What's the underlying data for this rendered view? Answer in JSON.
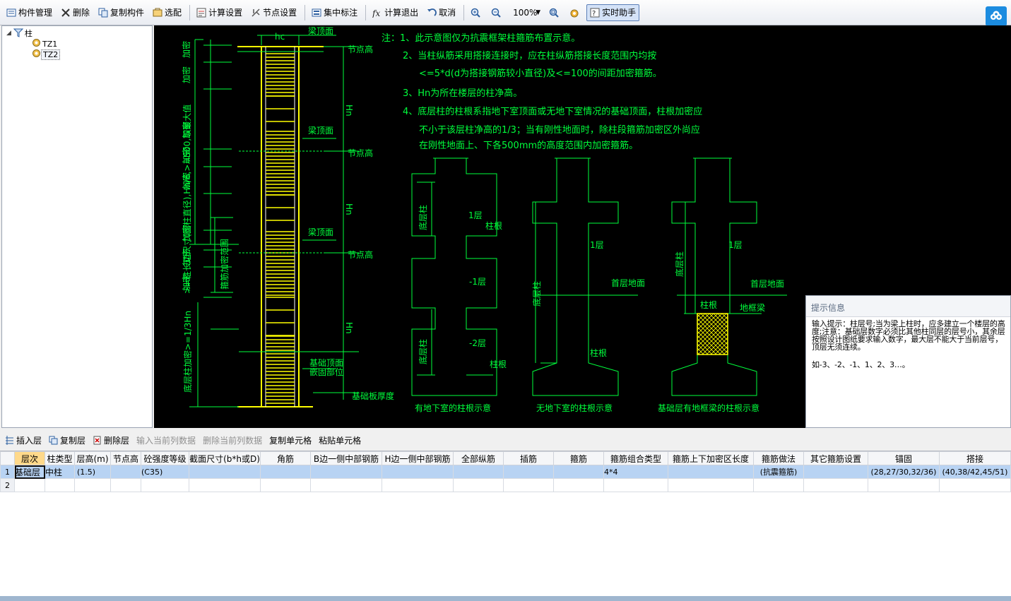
{
  "toolbar": {
    "component_manage": "构件管理",
    "delete": "删除",
    "copy_component": "复制构件",
    "select": "选配",
    "calc_settings": "计算设置",
    "node_settings": "节点设置",
    "centralized_label": "集中标注",
    "calc_exit": "计算退出",
    "cancel": "取消",
    "zoom_value": "100%",
    "realtime_helper": "实时助手"
  },
  "tree": {
    "root": "柱",
    "items": [
      "TZ1",
      "TZ2"
    ],
    "selected": "TZ2"
  },
  "drawing": {
    "notes": [
      "注：1、此示意图仅为抗震框架柱箍筋布置示意。",
      "2、当柱纵筋采用搭接连接时，应在柱纵筋搭接长度范围内均按",
      "<=5*d(d为搭接钢筋较小直径)及<=100的间距加密箍筋。",
      "3、Hn为所在楼层的柱净高。",
      "4、底层柱的柱根系指地下室顶面或无地下室情况的基础顶面，柱根加密应",
      "不小于该层柱净高的1/3；当有刚性地面时，除柱段箍筋加密区外尚应",
      "在刚性地面上、下各500mm的高度范围内加密箍筋。"
    ],
    "labels": {
      "hc": "hc",
      "beam_top": "梁顶面",
      "node_height": "节点高",
      "hn": "Hn",
      "dense": "加密",
      "left_rule": ">=柱长边尺寸(圆柱直径),Hn/6,>=500,取最大值",
      "stirrup_range": "箍筋加密范围",
      "bottom_rule": "底层柱加密>=1/3Hn",
      "foundation_top": "基础顶面",
      "embed_part": "嵌固部位",
      "foundation_thickness": "基础板厚度",
      "bottom_col": "底层柱",
      "floor1": "1层",
      "col_root": "柱根",
      "floor_m1": "-1层",
      "floor_m2": "-2层",
      "ground": "首层地面",
      "ground_beam": "地框梁",
      "caption1": "有地下室的柱根示意",
      "caption2": "无地下室的柱根示意",
      "caption3": "基础层有地框梁的柱根示意"
    }
  },
  "hint": {
    "title": "提示信息",
    "text": "输入提示：柱层号;当为梁上柱时，应多建立一个楼层的高度;注意：基础层数字必须比其他柱同层的层号小，其余层按照设计图纸要求输入数字，最大层不能大于当前层号，顶层无须连续。",
    "example": "如-3、-2、-1、1、2、3…。"
  },
  "layer_toolbar": {
    "insert_layer": "插入层",
    "copy_layer": "复制层",
    "delete_layer": "删除层",
    "input_col_data": "输入当前列数据",
    "delete_col_data": "删除当前列数据",
    "copy_cell": "复制单元格",
    "paste_cell": "粘贴单元格"
  },
  "table": {
    "columns": [
      "层次",
      "柱类型",
      "层高(m)",
      "节点高",
      "砼强度等级",
      "截面尺寸(b*h或D)",
      "角筋",
      "B边一侧中部钢筋",
      "H边一侧中部钢筋",
      "全部纵筋",
      "插筋",
      "箍筋",
      "箍筋组合类型",
      "箍筋上下加密区长度",
      "箍筋做法",
      "其它箍筋设置",
      "锚固",
      "搭接"
    ],
    "rows": [
      [
        "1",
        "基础层",
        "中柱",
        "(1.5)",
        "",
        "(C35)",
        "",
        "",
        "",
        "",
        "",
        "",
        "",
        "4*4",
        "",
        "(抗震箍筋)",
        "",
        "(28,27/30,32/36)",
        "(40,38/42,45/51)"
      ],
      [
        "2",
        "",
        "",
        "",
        "",
        "",
        "",
        "",
        "",
        "",
        "",
        "",
        "",
        "",
        "",
        "",
        "",
        "",
        ""
      ]
    ]
  }
}
